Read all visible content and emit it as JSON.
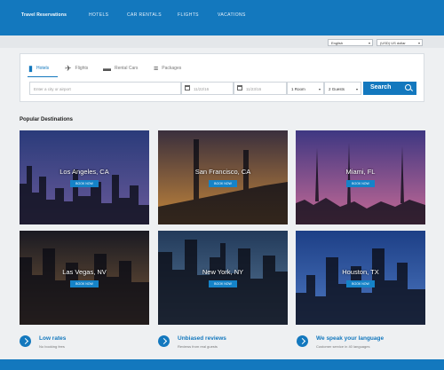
{
  "header": {
    "brand": "Travel Reservations",
    "nav": [
      "HOTELS",
      "CAR RENTALS",
      "FLIGHTS",
      "VACATIONS"
    ]
  },
  "subbar": {
    "language": "English",
    "currency": "(USD) US dollar"
  },
  "search": {
    "tabs": [
      {
        "label": "Hotels",
        "icon": "hotel-icon",
        "active": true
      },
      {
        "label": "Flights",
        "icon": "plane-icon",
        "active": false
      },
      {
        "label": "Rental Cars",
        "icon": "car-icon",
        "active": false
      },
      {
        "label": "Packages",
        "icon": "package-icon",
        "active": false
      }
    ],
    "destination_placeholder": "Enter a city or airport",
    "checkin": "11/22/16",
    "checkout": "11/23/16",
    "rooms": "1 Room",
    "guests": "2 Guests",
    "button_label": "Search"
  },
  "popular": {
    "title": "Popular Destinations",
    "book_label": "BOOK NOW",
    "cities": [
      {
        "name": "Los Angeles, CA",
        "sky": "#2a3b7a",
        "sky2": "#6a5a9a"
      },
      {
        "name": "San Francisco, CA",
        "sky": "#3a2f3d",
        "sky2": "#c4863a"
      },
      {
        "name": "Miami, FL",
        "sky": "#3e3782",
        "sky2": "#c76a95"
      },
      {
        "name": "Las Vegas, NV",
        "sky": "#1a1a22",
        "sky2": "#7a5a3a"
      },
      {
        "name": "New York, NY",
        "sky": "#223a5a",
        "sky2": "#5a7a9a"
      },
      {
        "name": "Houston, TX",
        "sky": "#1d3f86",
        "sky2": "#4e79c2"
      }
    ]
  },
  "features": [
    {
      "title": "Low rates",
      "subtitle": "No booking fees"
    },
    {
      "title": "Unbiased reviews",
      "subtitle": "Reviews from real guests"
    },
    {
      "title": "We speak your language",
      "subtitle": "Customer service in 40 languages"
    }
  ]
}
